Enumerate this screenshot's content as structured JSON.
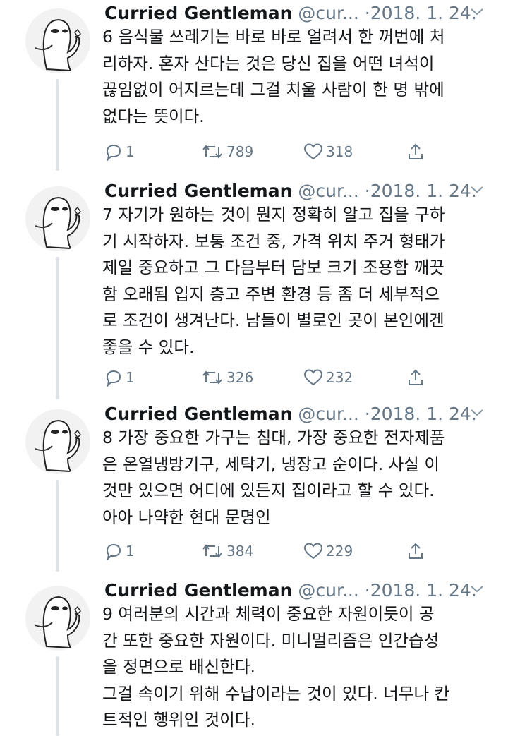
{
  "author": {
    "name": "Curried Gentleman",
    "handle": "@cur...",
    "separator": "·",
    "date": "2018. 1. 24."
  },
  "icons": {
    "avatar": "ghost-avatar-icon",
    "menu": "chevron-down-icon",
    "reply": "reply-bubble-icon",
    "retweet": "retweet-icon",
    "like": "heart-icon",
    "share": "share-upload-icon"
  },
  "colors": {
    "text": "#14171a",
    "muted": "#657786",
    "thread_line": "#dfe3e7"
  },
  "tweets": [
    {
      "text": "6 음식물 쓰레기는 바로 바로 얼려서 한 꺼번에 처\n리하자. 혼자 산다는 것은 당신 집을 어떤 녀석이\n끊임없이 어지르는데 그걸 치울 사람이 한 명 밖에\n없다는 뜻이다.",
      "replies": "1",
      "retweets": "789",
      "likes": "318"
    },
    {
      "text": "7 자기가 원하는 것이 뭔지 정확히 알고 집을 구하\n기 시작하자. 보통 조건 중, 가격 위치 주거 형태가\n제일 중요하고 그 다음부터 담보 크기 조용함 깨끗\n함 오래됨 입지 층고 주변 환경 등 좀 더 세부적으\n로 조건이 생겨난다. 남들이 별로인 곳이 본인에겐\n좋을 수 있다.",
      "replies": "1",
      "retweets": "326",
      "likes": "232"
    },
    {
      "text": "8 가장 중요한 가구는 침대, 가장 중요한 전자제품\n은 온열냉방기구, 세탁기, 냉장고 순이다. 사실 이\n것만 있으면 어디에 있든지 집이라고 할 수 있다.\n아아 나약한 현대 문명인",
      "replies": "1",
      "retweets": "384",
      "likes": "229"
    },
    {
      "text": "9 여러분의 시간과 체력이 중요한 자원이듯이 공\n간 또한 중요한 자원이다. 미니멀리즘은 인간습성\n을 정면으로 배신한다.\n그걸 속이기 위해 수납이라는 것이 있다. 너무나 칸\n트적인 행위인 것이다."
    }
  ]
}
